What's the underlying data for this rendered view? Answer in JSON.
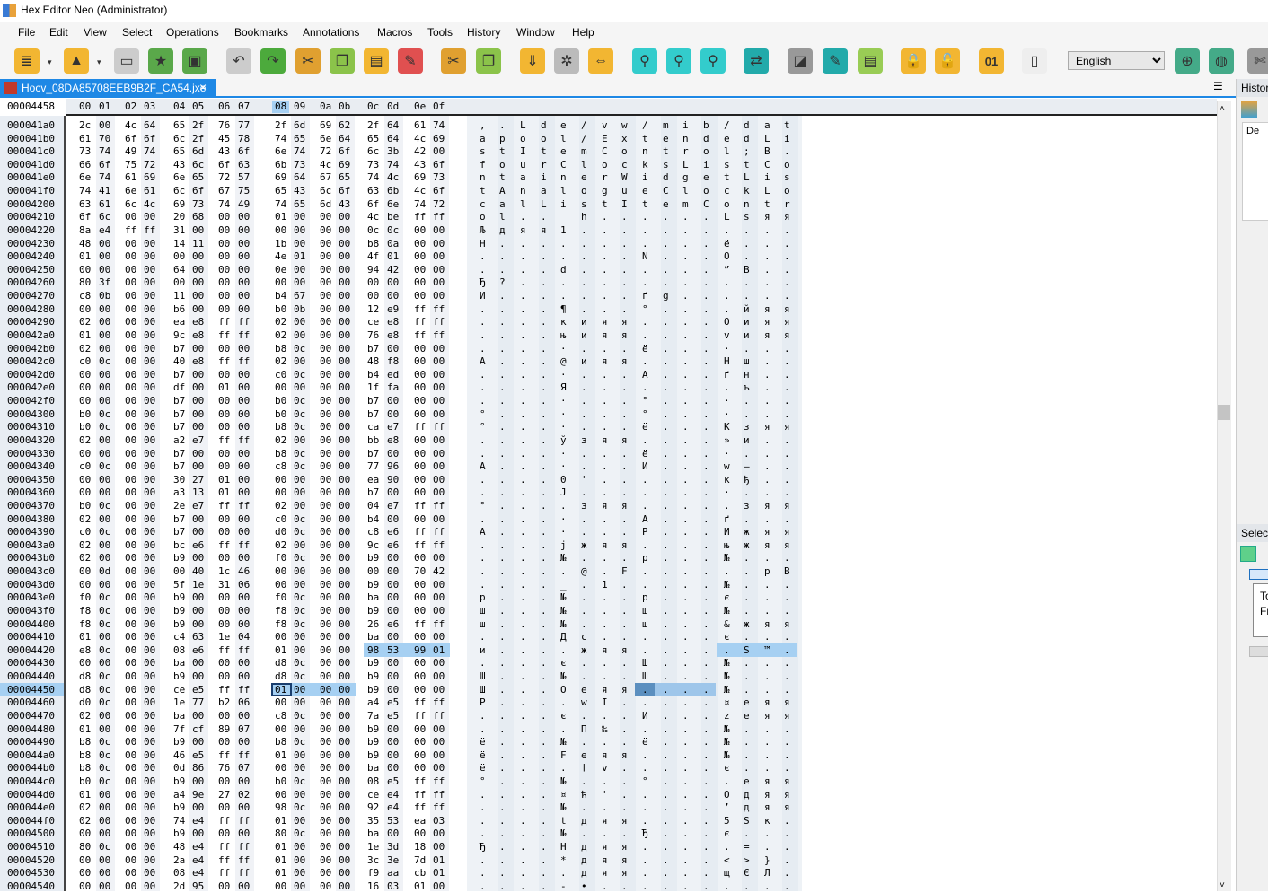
{
  "window": {
    "title": "Hex Editor Neo (Administrator)"
  },
  "menu": [
    "File",
    "Edit",
    "View",
    "Select",
    "Operations",
    "Bookmarks",
    "Annotations",
    "Macros",
    "Tools",
    "History",
    "Window",
    "Help"
  ],
  "toolbar": {
    "icons": [
      "new-file-icon",
      "open-file-icon",
      "save-icon",
      "save-as-icon",
      "save-all-icon",
      "undo-icon",
      "redo-icon",
      "cut-icon",
      "copy-icon",
      "paste-icon",
      "pencil-icon",
      "cut-special-icon",
      "copy-special-icon",
      "insert-file-icon",
      "settings-icon",
      "resize-icon",
      "find-icon",
      "find-next-icon",
      "find-previous-icon",
      "replace-icon",
      "fill-icon",
      "modify-icon",
      "annotate-icon",
      "lock-icon",
      "unlock-icon",
      "binary-icon",
      "column-icon",
      "web-add-icon",
      "web-user-icon",
      "tools-icon"
    ],
    "language": "English"
  },
  "tab": {
    "label": "Hocv_08DA85708EEB9B2F_CA54.jxe"
  },
  "editor": {
    "current_offset": "00004458",
    "columns": [
      "00",
      "01",
      "02",
      "03",
      "04",
      "05",
      "06",
      "07",
      "08",
      "09",
      "0a",
      "0b",
      "0c",
      "0d",
      "0e",
      "0f"
    ],
    "rows": [
      [
        "000041a0",
        "2c 00 4c 64 65 2f 76 77 2f 6d 69 62 2f 64 61 74"
      ],
      [
        "000041b0",
        "61 70 6f 6f 6c 2f 45 78 74 65 6e 64 65 64 4c 69"
      ],
      [
        "000041c0",
        "73 74 49 74 65 6d 43 6f 6e 74 72 6f 6c 3b 42 00"
      ],
      [
        "000041d0",
        "66 6f 75 72 43 6c 6f 63 6b 73 4c 69 73 74 43 6f"
      ],
      [
        "000041e0",
        "6e 74 61 69 6e 65 72 57 69 64 67 65 74 4c 69 73"
      ],
      [
        "000041f0",
        "74 41 6e 61 6c 6f 67 75 65 43 6c 6f 63 6b 4c 6f"
      ],
      [
        "00004200",
        "63 61 6c 4c 69 73 74 49 74 65 6d 43 6f 6e 74 72"
      ],
      [
        "00004210",
        "6f 6c 00 00 20 68 00 00 01 00 00 00 4c be ff ff"
      ],
      [
        "00004220",
        "8a e4 ff ff 31 00 00 00 00 00 00 00 0c 0c 00 00"
      ],
      [
        "00004230",
        "48 00 00 00 14 11 00 00 1b 00 00 00 b8 0a 00 00"
      ],
      [
        "00004240",
        "01 00 00 00 00 00 00 00 4e 01 00 00 4f 01 00 00"
      ],
      [
        "00004250",
        "00 00 00 00 64 00 00 00 0e 00 00 00 94 42 00 00"
      ],
      [
        "00004260",
        "80 3f 00 00 00 00 00 00 00 00 00 00 00 00 00 00"
      ],
      [
        "00004270",
        "c8 0b 00 00 11 00 00 00 b4 67 00 00 00 00 00 00"
      ],
      [
        "00004280",
        "00 00 00 00 b6 00 00 00 b0 0b 00 00 12 e9 ff ff"
      ],
      [
        "00004290",
        "02 00 00 00 ea e8 ff ff 02 00 00 00 ce e8 ff ff"
      ],
      [
        "000042a0",
        "01 00 00 00 9c e8 ff ff 02 00 00 00 76 e8 ff ff"
      ],
      [
        "000042b0",
        "02 00 00 00 b7 00 00 00 b8 0c 00 00 b7 00 00 00"
      ],
      [
        "000042c0",
        "c0 0c 00 00 40 e8 ff ff 02 00 00 00 48 f8 00 00"
      ],
      [
        "000042d0",
        "00 00 00 00 b7 00 00 00 c0 0c 00 00 b4 ed 00 00"
      ],
      [
        "000042e0",
        "00 00 00 00 df 00 01 00 00 00 00 00 1f fa 00 00"
      ],
      [
        "000042f0",
        "00 00 00 00 b7 00 00 00 b0 0c 00 00 b7 00 00 00"
      ],
      [
        "00004300",
        "b0 0c 00 00 b7 00 00 00 b0 0c 00 00 b7 00 00 00"
      ],
      [
        "00004310",
        "b0 0c 00 00 b7 00 00 00 b8 0c 00 00 ca e7 ff ff"
      ],
      [
        "00004320",
        "02 00 00 00 a2 e7 ff ff 02 00 00 00 bb e8 00 00"
      ],
      [
        "00004330",
        "00 00 00 00 b7 00 00 00 b8 0c 00 00 b7 00 00 00"
      ],
      [
        "00004340",
        "c0 0c 00 00 b7 00 00 00 c8 0c 00 00 77 96 00 00"
      ],
      [
        "00004350",
        "00 00 00 00 30 27 01 00 00 00 00 00 ea 90 00 00"
      ],
      [
        "00004360",
        "00 00 00 00 a3 13 01 00 00 00 00 00 b7 00 00 00"
      ],
      [
        "00004370",
        "b0 0c 00 00 2e e7 ff ff 02 00 00 00 04 e7 ff ff"
      ],
      [
        "00004380",
        "02 00 00 00 b7 00 00 00 c0 0c 00 00 b4 00 00 00"
      ],
      [
        "00004390",
        "c0 0c 00 00 b7 00 00 00 d0 0c 00 00 c8 e6 ff ff"
      ],
      [
        "000043a0",
        "02 00 00 00 bc e6 ff ff 02 00 00 00 9c e6 ff ff"
      ],
      [
        "000043b0",
        "02 00 00 00 b9 00 00 00 f0 0c 00 00 b9 00 00 00"
      ],
      [
        "000043c0",
        "00 0d 00 00 00 40 1c 46 00 00 00 00 00 00 70 42"
      ],
      [
        "000043d0",
        "00 00 00 00 5f 1e 31 06 00 00 00 00 b9 00 00 00"
      ],
      [
        "000043e0",
        "f0 0c 00 00 b9 00 00 00 f0 0c 00 00 ba 00 00 00"
      ],
      [
        "000043f0",
        "f8 0c 00 00 b9 00 00 00 f8 0c 00 00 b9 00 00 00"
      ],
      [
        "00004400",
        "f8 0c 00 00 b9 00 00 00 f8 0c 00 00 26 e6 ff ff"
      ],
      [
        "00004410",
        "01 00 00 00 c4 63 1e 04 00 00 00 00 ba 00 00 00"
      ],
      [
        "00004420",
        "e8 0c 00 00 08 e6 ff ff 01 00 00 00 98 53 99 01"
      ],
      [
        "00004430",
        "00 00 00 00 ba 00 00 00 d8 0c 00 00 b9 00 00 00"
      ],
      [
        "00004440",
        "d8 0c 00 00 b9 00 00 00 d8 0c 00 00 b9 00 00 00"
      ],
      [
        "00004450",
        "d8 0c 00 00 ce e5 ff ff 01 00 00 00 b9 00 00 00"
      ],
      [
        "00004460",
        "d0 0c 00 00 1e 77 b2 06 00 00 00 00 a4 e5 ff ff"
      ],
      [
        "00004470",
        "02 00 00 00 ba 00 00 00 c8 0c 00 00 7a e5 ff ff"
      ],
      [
        "00004480",
        "01 00 00 00 7f cf 89 07 00 00 00 00 b9 00 00 00"
      ],
      [
        "00004490",
        "b8 0c 00 00 b9 00 00 00 b8 0c 00 00 b9 00 00 00"
      ],
      [
        "000044a0",
        "b8 0c 00 00 46 e5 ff ff 01 00 00 00 b9 00 00 00"
      ],
      [
        "000044b0",
        "b8 0c 00 00 0d 86 76 07 00 00 00 00 ba 00 00 00"
      ],
      [
        "000044c0",
        "b0 0c 00 00 b9 00 00 00 b0 0c 00 00 08 e5 ff ff"
      ],
      [
        "000044d0",
        "01 00 00 00 a4 9e 27 02 00 00 00 00 ce e4 ff ff"
      ],
      [
        "000044e0",
        "02 00 00 00 b9 00 00 00 98 0c 00 00 92 e4 ff ff"
      ],
      [
        "000044f0",
        "02 00 00 00 74 e4 ff ff 01 00 00 00 35 53 ea 03"
      ],
      [
        "00004500",
        "00 00 00 00 b9 00 00 00 80 0c 00 00 ba 00 00 00"
      ],
      [
        "00004510",
        "80 0c 00 00 48 e4 ff ff 01 00 00 00 1e 3d 18 00"
      ],
      [
        "00004520",
        "00 00 00 00 2a e4 ff ff 01 00 00 00 3c 3e 7d 01"
      ],
      [
        "00004530",
        "00 00 00 00 08 e4 ff ff 01 00 00 00 f9 aa cb 01"
      ],
      [
        "00004540",
        "00 00 00 00 2d 95 00 00 00 00 00 00 16 03 01 00"
      ]
    ],
    "selection": [
      {
        "row": "00004420",
        "from": 12,
        "to": 15
      },
      {
        "row": "00004450",
        "from": 8,
        "to": 11
      }
    ],
    "cursor": {
      "row": "00004450",
      "column": 8
    }
  },
  "right_panel": {
    "history_title": "Histor",
    "history_item": "De",
    "selection_title": "Select",
    "sel_to": "To",
    "sel_from": "Fr"
  },
  "colors": {
    "accent": "#1e88e5",
    "selection": "#a6d0f2",
    "cursor_text": "#5b9bd5"
  }
}
